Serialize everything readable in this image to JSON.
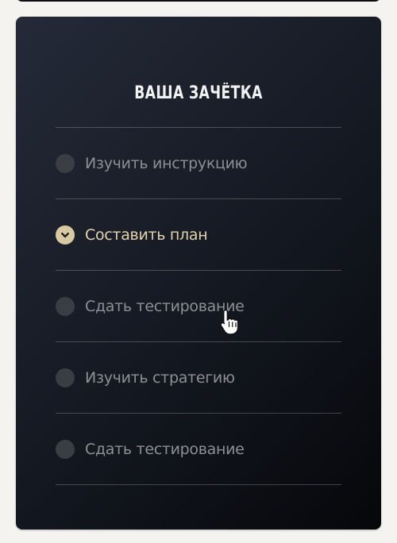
{
  "card": {
    "title": "ВАША ЗАЧЁТКА"
  },
  "checklist": {
    "items": [
      {
        "label": "Изучить инструкцию",
        "checked": false
      },
      {
        "label": "Составить план",
        "checked": true
      },
      {
        "label": "Сдать тестирование",
        "checked": false
      },
      {
        "label": "Изучить стратегию",
        "checked": false
      },
      {
        "label": "Сдать тестирование",
        "checked": false
      }
    ]
  },
  "colors": {
    "card_background": "#161a22",
    "accent_gold": "#d9c9a3",
    "muted_text": "#8d8f94",
    "radio_empty": "#3a3d44"
  },
  "icons": {
    "checked": "chevron-down-icon",
    "cursor": "hand-pointer-icon"
  }
}
